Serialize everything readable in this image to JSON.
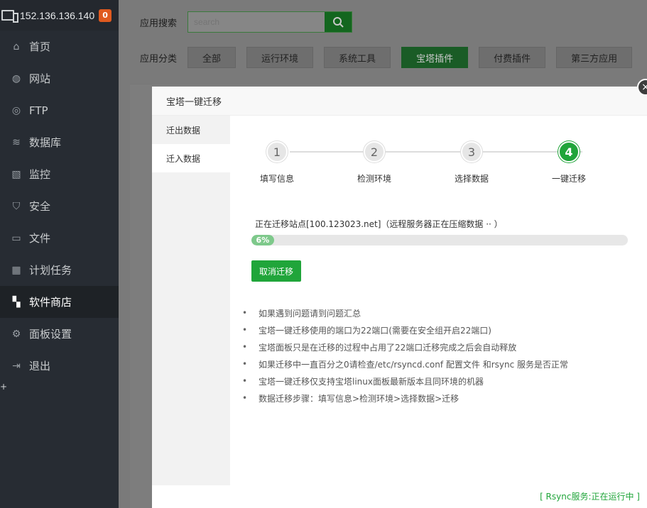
{
  "server": {
    "ip": "152.136.136.140",
    "badge": "0"
  },
  "sidebar": {
    "items": [
      {
        "label": "首页",
        "icon": "home-icon",
        "glyph": "⌂"
      },
      {
        "label": "网站",
        "icon": "globe-icon",
        "glyph": "◍"
      },
      {
        "label": "FTP",
        "icon": "ftp-icon",
        "glyph": "◎"
      },
      {
        "label": "数据库",
        "icon": "database-icon",
        "glyph": "≋"
      },
      {
        "label": "监控",
        "icon": "monitor-chart-icon",
        "glyph": "▧"
      },
      {
        "label": "安全",
        "icon": "shield-icon",
        "glyph": "⛉"
      },
      {
        "label": "文件",
        "icon": "folder-icon",
        "glyph": "▭"
      },
      {
        "label": "计划任务",
        "icon": "calendar-icon",
        "glyph": "▦"
      },
      {
        "label": "软件商店",
        "icon": "apps-grid-icon",
        "glyph": "▚"
      },
      {
        "label": "面板设置",
        "icon": "gear-icon",
        "glyph": "⚙"
      },
      {
        "label": "退出",
        "icon": "logout-icon",
        "glyph": "⇥"
      }
    ],
    "add_symbol": "+"
  },
  "toolbar": {
    "search_label": "应用搜索",
    "search_placeholder": "search",
    "category_label": "应用分类",
    "categories": [
      "全部",
      "运行环境",
      "系统工具",
      "宝塔插件",
      "付费插件",
      "第三方应用"
    ]
  },
  "modal": {
    "title": "宝塔一键迁移",
    "close_symbol": "×",
    "tabs": [
      "迁出数据",
      "迁入数据"
    ],
    "steps": [
      {
        "num": "1",
        "label": "填写信息"
      },
      {
        "num": "2",
        "label": "检测环境"
      },
      {
        "num": "3",
        "label": "选择数据"
      },
      {
        "num": "4",
        "label": "一键迁移"
      }
    ],
    "status_text": "正在迁移站点[100.123023.net]（远程服务器正在压缩数据 ··  ）",
    "progress": {
      "value": 6,
      "label": "6%"
    },
    "cancel_label": "取消迁移",
    "tips": [
      "如果遇到问题请到问题汇总",
      "宝塔一键迁移使用的端口为22端口(需要在安全组开启22端口)",
      "宝塔面板只是在迁移的过程中占用了22端口迁移完成之后会自动释放",
      "如果迁移中一直百分之0请检查/etc/rsyncd.conf 配置文件 和rsync 服务是否正常",
      "宝塔一键迁移仅支持宝塔linux面板最新版本且同环境的机器",
      "数据迁移步骤：填写信息>检测环境>选择数据>迁移"
    ],
    "rsync_status": "[ Rsync服务:正在运行中 ]"
  },
  "colors": {
    "accent": "#20a53a",
    "sidebar_bg": "#272c33",
    "badge": "#e05a1f"
  }
}
